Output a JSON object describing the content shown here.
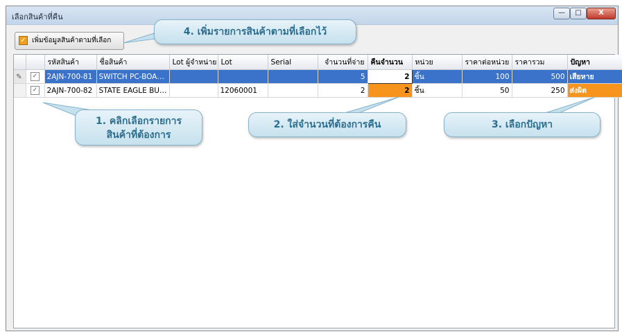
{
  "window": {
    "title": "เลือกสินค้าที่คืน",
    "min_label": "—",
    "max_label": "□",
    "close_label": "X"
  },
  "toolbar": {
    "add_checkbox_glyph": "✓",
    "add_button_label": "เพิ่มข้อมูลสินค้าตามที่เลือก"
  },
  "grid": {
    "columns": [
      "",
      "",
      "รหัสสินค้า",
      "ชื่อสินค้า",
      "Lot ผู้จำหน่าย",
      "Lot",
      "Serial",
      "จำนวนที่จ่าย",
      "คืนจำนวน",
      "หน่วย",
      "ราคาต่อหน่วย",
      "ราคารวม",
      "ปัญหา"
    ],
    "rows": [
      {
        "indicator": "✎",
        "checked": "✓",
        "code": "2AJN-700-81",
        "name": "SWITCH PC-BOA…",
        "vendor_lot": "",
        "lot": "",
        "serial": "",
        "qty_issued": "5",
        "return_qty": "2",
        "unit": "ชิ้น",
        "unit_price": "100",
        "total": "500",
        "problem": "เสียหาย"
      },
      {
        "indicator": "",
        "checked": "✓",
        "code": "2AJN-700-82",
        "name": "STATE EAGLE BU…",
        "vendor_lot": "",
        "lot": "12060001",
        "serial": "",
        "qty_issued": "2",
        "return_qty": "2",
        "unit": "ชิ้น",
        "unit_price": "50",
        "total": "250",
        "problem": "ส่งผิด"
      }
    ]
  },
  "callouts": {
    "step1": "1. คลิกเลือกรายการ",
    "step1_line2": "สินค้าที่ต้องการ",
    "step2": "2. ใส่จำนวนที่ต้องการคืน",
    "step3": "3. เลือกปัญหา",
    "step4": "4. เพิ่มรายการสินค้าตามที่เลือกไว้"
  },
  "colors": {
    "selection": "#3a73c9",
    "highlight_orange": "#f7941d",
    "callout_text": "#2c6e8f"
  }
}
